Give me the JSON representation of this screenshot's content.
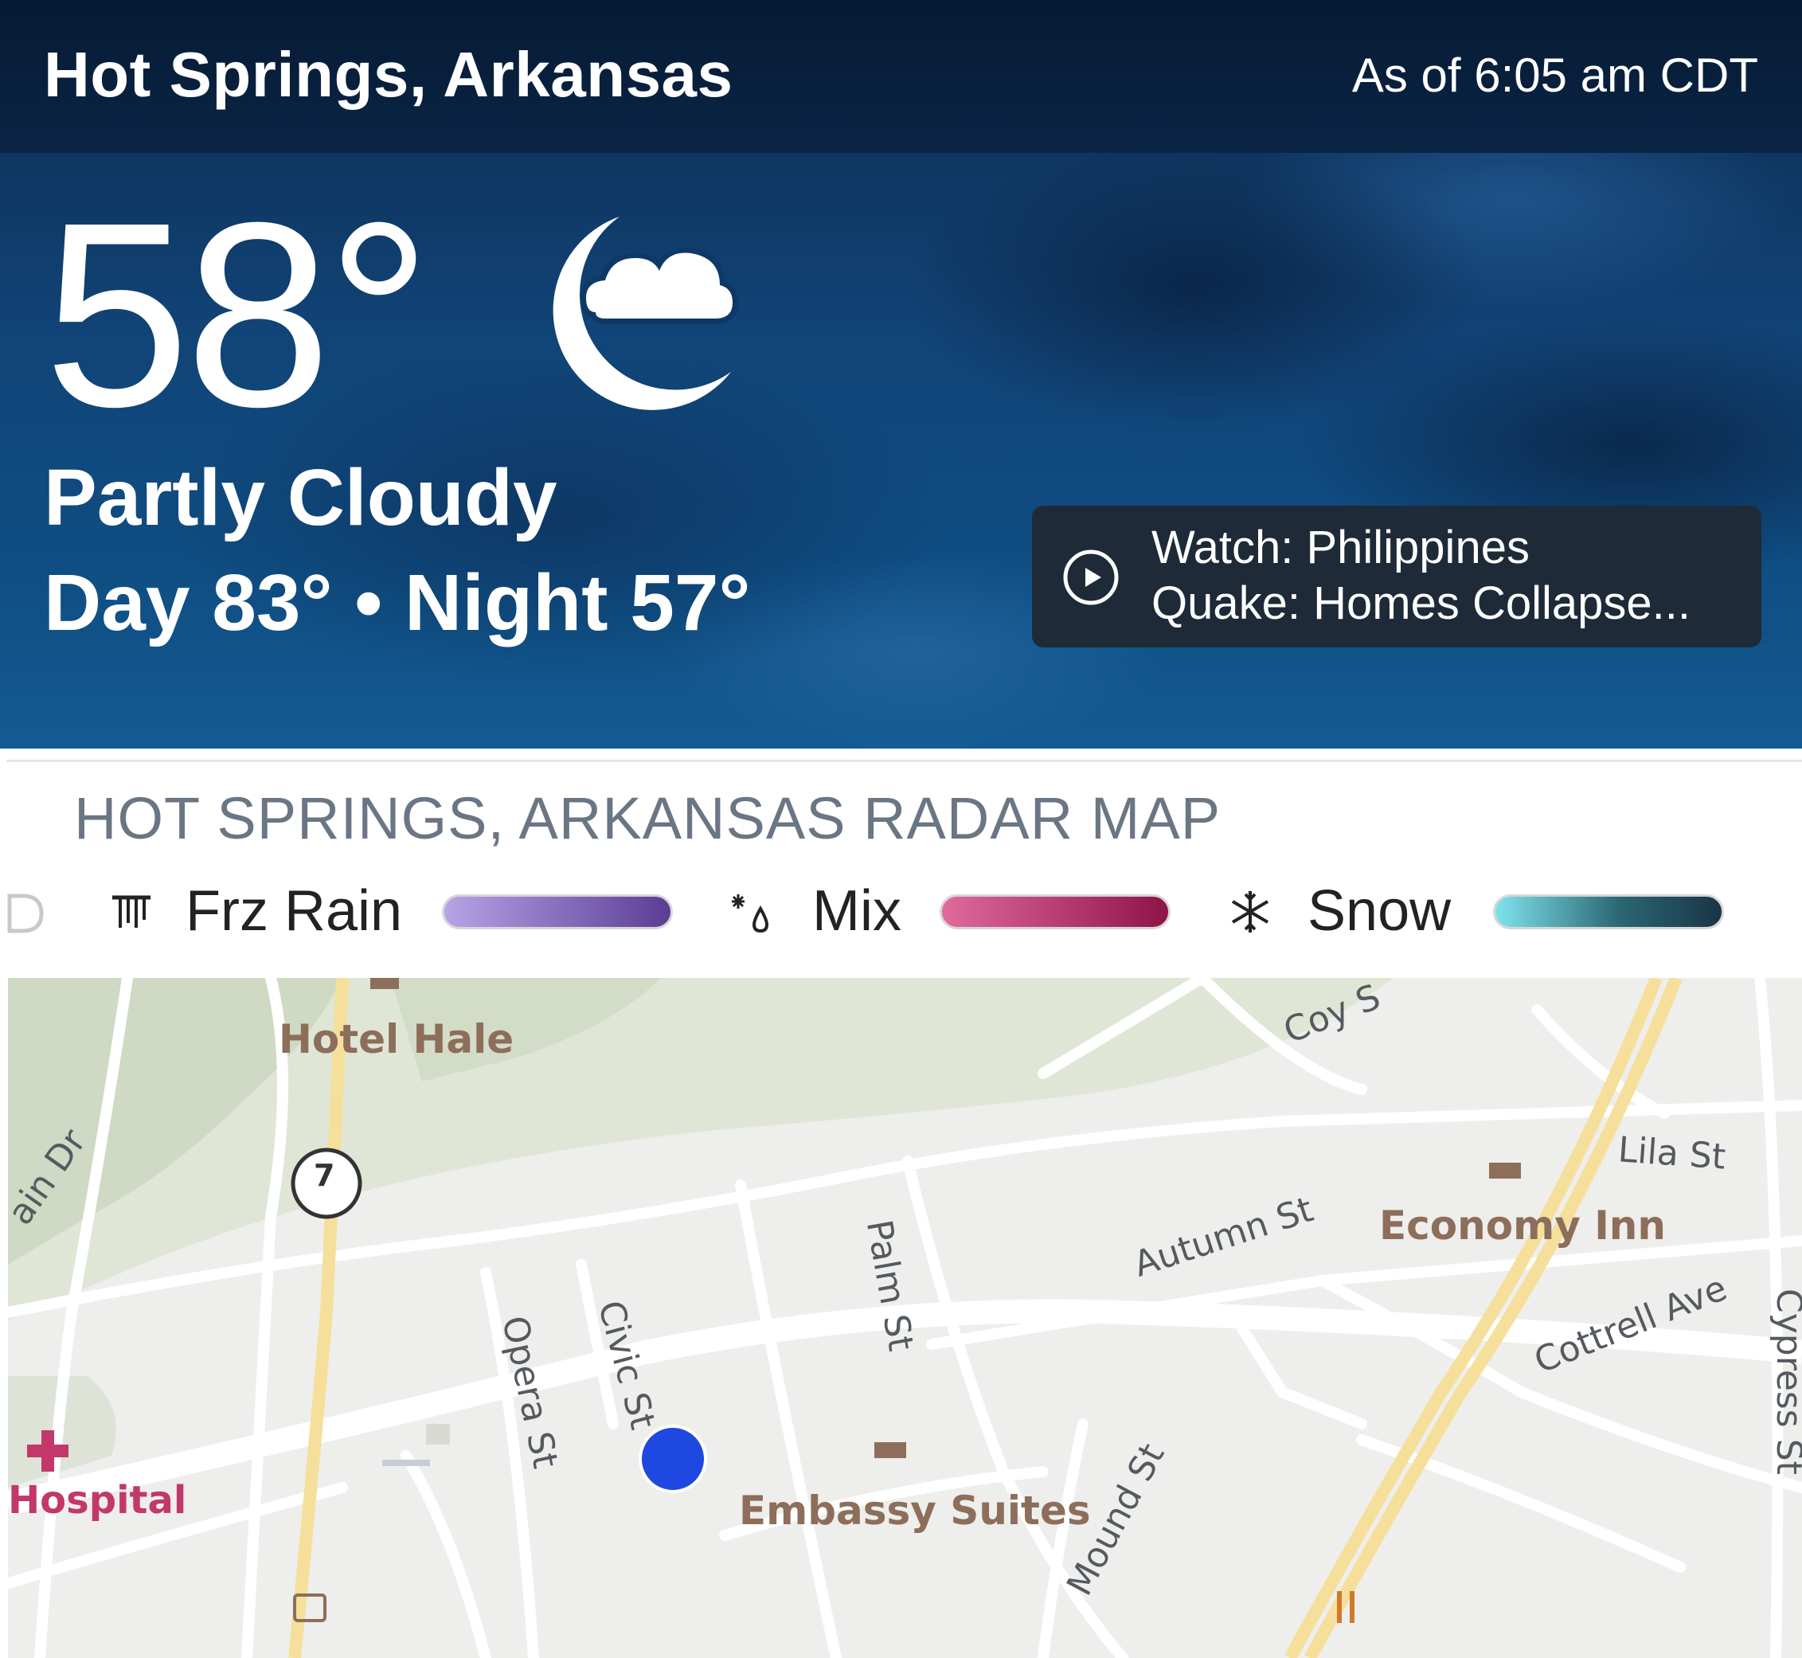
{
  "header": {
    "location": "Hot Springs, Arkansas",
    "as_of": "As of 6:05 am CDT"
  },
  "current": {
    "temperature": "58°",
    "condition": "Partly Cloudy",
    "day_night": "Day 83° • Night 57°",
    "icon": "night-partly-cloudy-icon"
  },
  "video": {
    "line1": "Watch: Philippines",
    "line2": "Quake: Homes Collapse...",
    "icon": "play-icon"
  },
  "radar": {
    "title": "HOT SPRINGS, ARKANSAS RADAR MAP",
    "legend": [
      {
        "label": "Frz Rain",
        "icon": "freezing-rain-icon",
        "colors": [
          "#b7a3e6",
          "#5b3d94"
        ]
      },
      {
        "label": "Mix",
        "icon": "mix-icon",
        "colors": [
          "#e06a9c",
          "#8e1448"
        ]
      },
      {
        "label": "Snow",
        "icon": "snowflake-icon",
        "colors": [
          "#7fe3ec",
          "#1a3447"
        ]
      }
    ]
  },
  "map": {
    "pois": {
      "hotel_hale": "Hotel Hale",
      "economy_inn": "Economy Inn",
      "embassy_suites": "Embassy Suites",
      "hospital": "Hospital"
    },
    "streets": {
      "coy": "Coy S",
      "lila": "Lila St",
      "autumn": "Autumn St",
      "palm": "Palm St",
      "opera": "Opera St",
      "civic": "Civic St",
      "cottrell": "Cottrell Ave",
      "cypress": "Cypress St",
      "mound": "Mound St",
      "mountain_dr": "ain Dr"
    },
    "highway_shield": "7"
  },
  "colors": {
    "accent_dark": "#061a33",
    "card_bg": "#1e2a37",
    "location_dot": "#1f48e0",
    "map_road_major": "#f6df9a",
    "map_park": "#dfe6d5"
  }
}
